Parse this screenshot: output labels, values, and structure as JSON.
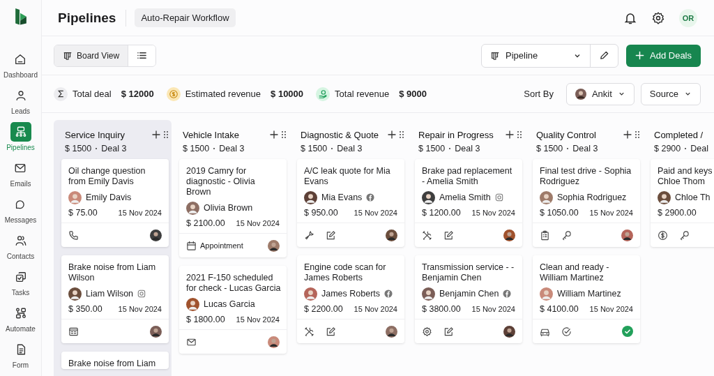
{
  "sidebar": {
    "items": [
      {
        "label": "Dashboard",
        "selected": false
      },
      {
        "label": "Leads",
        "selected": false
      },
      {
        "label": "Pipelines",
        "selected": true
      },
      {
        "label": "Emails",
        "selected": false
      },
      {
        "label": "Messages",
        "selected": false
      },
      {
        "label": "Contacts",
        "selected": false
      },
      {
        "label": "Tasks",
        "selected": false
      },
      {
        "label": "Automate",
        "selected": false
      },
      {
        "label": "Form",
        "selected": false
      }
    ]
  },
  "header": {
    "title": "Pipelines",
    "workflow": "Auto-Repair Workflow",
    "user_initials": "OR"
  },
  "toolbar": {
    "views": [
      {
        "label": "Board View",
        "selected": true
      },
      {
        "selected": false
      }
    ],
    "pipeline_select": "Pipeline",
    "add_button": "Add Deals"
  },
  "stats": [
    {
      "label": "Total deal",
      "value": "$ 12000"
    },
    {
      "label": "Estimated revenue",
      "value": "$ 10000"
    },
    {
      "label": "Total revenue",
      "value": "$ 9000"
    }
  ],
  "sort": {
    "label": "Sort By",
    "owner": "Ankit",
    "source": "Source"
  },
  "columns": [
    {
      "title": "Service Inquiry",
      "amount": "$ 1500",
      "deals": "Deal 3",
      "selected": true,
      "show_actions": true,
      "cards": [
        {
          "title": "Oil change question from Emily Davis",
          "contact": "Emily Davis",
          "amount": "$ 75.00",
          "date": "15 Nov 2024",
          "footer": [
            {
              "kind": "phone"
            },
            {
              "kind": "avatar"
            }
          ]
        },
        {
          "title": "Brake noise from Liam Wilson",
          "contact": "Liam Wilson",
          "social": {
            "kind": "instagram"
          },
          "amount": "$ 350.00",
          "date": "15 Nov 2024",
          "footer": [
            {
              "kind": "browser"
            },
            {
              "kind": "avatar"
            }
          ]
        },
        {
          "title": "Brake noise from Liam"
        }
      ]
    },
    {
      "title": "Vehicle Intake",
      "amount": "$ 1500",
      "deals": "Deal 3",
      "selected": false,
      "show_actions": true,
      "cards": [
        {
          "title": "2019 Camry for diagnostic - Olivia Brown",
          "contact": "Olivia Brown",
          "amount": "$ 2100.00",
          "date": "15 Nov 2024",
          "footer": [
            {
              "kind": "calendar",
              "label": "Appointment"
            },
            {
              "kind": "avatar"
            }
          ]
        },
        {
          "title": "2021 F-150 scheduled for check - Lucas Garcia",
          "contact": "Lucas Garcia",
          "amount": "$ 1800.00",
          "date": "15 Nov 2024",
          "footer": [
            {
              "kind": "mail"
            },
            {
              "kind": "avatar"
            }
          ]
        }
      ]
    },
    {
      "title": "Diagnostic & Quote",
      "amount": "$ 1500",
      "deals": "Deal 3",
      "selected": false,
      "show_actions": true,
      "cards": [
        {
          "title": "A/C leak quote for Mia Evans",
          "contact": "Mia Evans",
          "social": {
            "kind": "facebook"
          },
          "amount": "$ 950.00",
          "date": "15 Nov 2024",
          "footer": [
            {
              "kind": "wrench"
            },
            {
              "kind": "edit"
            },
            {
              "kind": "avatar"
            }
          ]
        },
        {
          "title": "Engine code scan for James Roberts",
          "contact": "James Roberts",
          "social": {
            "kind": "facebook"
          },
          "amount": "$ 2200.00",
          "date": "15 Nov 2024",
          "footer": [
            {
              "kind": "tools"
            },
            {
              "kind": "edit"
            },
            {
              "kind": "avatar"
            }
          ]
        }
      ]
    },
    {
      "title": "Repair in Progress",
      "amount": "$ 1500",
      "deals": "Deal 3",
      "selected": false,
      "show_actions": true,
      "cards": [
        {
          "title": "Brake pad replacement - Amelia Smith",
          "contact": "Amelia Smith",
          "social": {
            "kind": "instagram"
          },
          "amount": "$ 1200.00",
          "date": "15 Nov 2024",
          "footer": [
            {
              "kind": "tools"
            },
            {
              "kind": "edit"
            },
            {
              "kind": "avatar"
            }
          ]
        },
        {
          "title": "Transmission service - - Benjamin Chen",
          "contact": "Benjamin Chen",
          "social": {
            "kind": "facebook"
          },
          "amount": "$ 3800.00",
          "date": "15 Nov 2024",
          "footer": [
            {
              "kind": "gear"
            },
            {
              "kind": "edit"
            },
            {
              "kind": "avatar"
            }
          ]
        }
      ]
    },
    {
      "title": "Quality Control",
      "amount": "$ 1500",
      "deals": "Deal 3",
      "selected": false,
      "show_actions": true,
      "cards": [
        {
          "title": "Final test drive - Sophia Rodriguez",
          "contact": "Sophia Rodriguez",
          "amount": "$ 1050.00",
          "date": "15 Nov 2024",
          "footer": [
            {
              "kind": "clipboard"
            },
            {
              "kind": "key"
            },
            {
              "kind": "avatar"
            }
          ]
        },
        {
          "title": "Clean and ready - William Martinez",
          "contact": "William Martinez",
          "amount": "$ 4100.00",
          "date": "15 Nov 2024",
          "footer": [
            {
              "kind": "car"
            },
            {
              "kind": "check"
            },
            {
              "kind": "done"
            }
          ]
        }
      ]
    },
    {
      "title": "Completed /",
      "amount": "$ 2900",
      "deals": "Deal",
      "selected": false,
      "cards": [
        {
          "title": "Paid and keys\nChloe Thom",
          "contact": "Chloe Th",
          "amount": "$ 2900.00",
          "footer": [
            {
              "kind": "dollar"
            },
            {
              "kind": "key"
            }
          ]
        }
      ]
    }
  ]
}
